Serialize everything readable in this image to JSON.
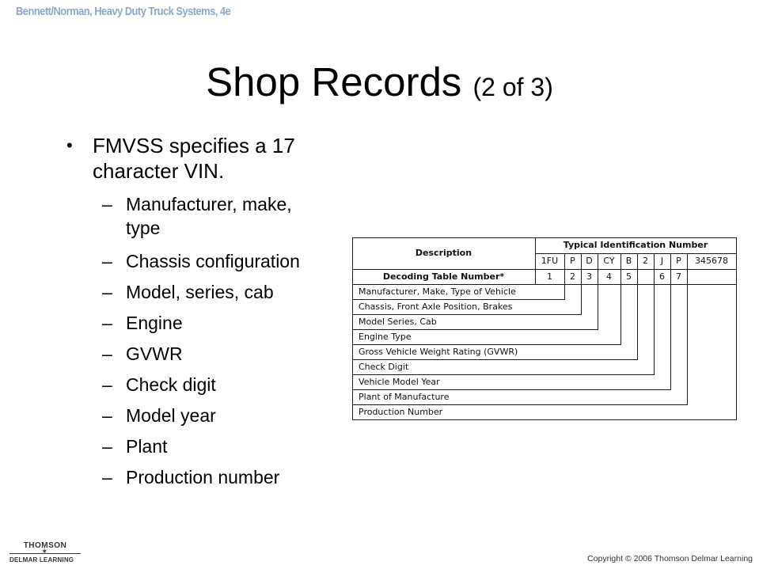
{
  "header": {
    "book_title": "Bennett/Norman, Heavy Duty Truck Systems, 4e"
  },
  "slide": {
    "title": "Shop Records",
    "title_suffix": "(2 of 3)"
  },
  "bullets": {
    "main": {
      "marker": "•",
      "text_line1": "FMVSS specifies a 17",
      "text_line2": "character VIN."
    },
    "sub_marker": "–",
    "sub_items": [
      {
        "line1": "Manufacturer, make,",
        "line2": "type"
      },
      {
        "line1": "Chassis configuration"
      },
      {
        "line1": "Model, series, cab"
      },
      {
        "line1": "Engine"
      },
      {
        "line1": "GVWR"
      },
      {
        "line1": "Check digit"
      },
      {
        "line1": "Model year"
      },
      {
        "line1": "Plant"
      },
      {
        "line1": "Production number"
      }
    ]
  },
  "vin_table": {
    "description_header": "Description",
    "vin_header": "Typical Identification Number",
    "vin_segments": [
      "1FU",
      "P",
      "D",
      "CY",
      "B",
      "2",
      "J",
      "P",
      "345678"
    ],
    "decoding_label": "Decoding Table Number*",
    "decoding_numbers": [
      "1",
      "2",
      "3",
      "4",
      "5",
      "",
      "6",
      "7",
      ""
    ],
    "rows": [
      "Manufacturer, Make, Type of Vehicle",
      "Chassis, Front Axle Position, Brakes",
      "Model Series, Cab",
      "Engine Type",
      "Gross Vehicle Weight Rating (GVWR)",
      "Check Digit",
      "Vehicle Model Year",
      "Plant of Manufacture",
      "Production Number"
    ]
  },
  "footer": {
    "logo_top": "THOMSON",
    "logo_star": "✶",
    "logo_bottom": "DELMAR LEARNING",
    "copyright": "Copyright © 2006 Thomson Delmar Learning"
  }
}
